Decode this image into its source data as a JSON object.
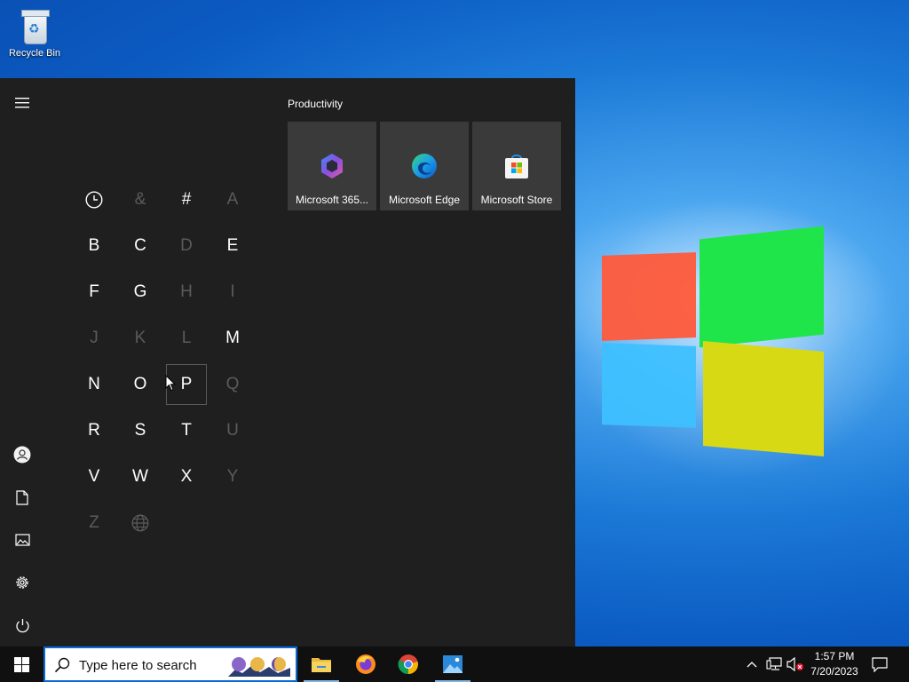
{
  "desktop": {
    "icons": [
      {
        "label": "Recycle Bin",
        "icon": "recycle-bin-icon"
      }
    ]
  },
  "start_menu": {
    "rail": [
      "hamburger-menu-icon",
      "user-icon",
      "documents-icon",
      "pictures-icon",
      "settings-icon",
      "power-icon"
    ],
    "letters": [
      {
        "text": "",
        "icon": "clock-icon",
        "active": true
      },
      {
        "text": "&",
        "active": false
      },
      {
        "text": "#",
        "active": true
      },
      {
        "text": "A",
        "active": false
      },
      {
        "text": "B",
        "active": true
      },
      {
        "text": "C",
        "active": true
      },
      {
        "text": "D",
        "active": false
      },
      {
        "text": "E",
        "active": true
      },
      {
        "text": "F",
        "active": true
      },
      {
        "text": "G",
        "active": true
      },
      {
        "text": "H",
        "active": false
      },
      {
        "text": "I",
        "active": false
      },
      {
        "text": "J",
        "active": false
      },
      {
        "text": "K",
        "active": false
      },
      {
        "text": "L",
        "active": false
      },
      {
        "text": "M",
        "active": true
      },
      {
        "text": "N",
        "active": true
      },
      {
        "text": "O",
        "active": true
      },
      {
        "text": "P",
        "active": true,
        "focused": true
      },
      {
        "text": "Q",
        "active": false
      },
      {
        "text": "R",
        "active": true
      },
      {
        "text": "S",
        "active": true
      },
      {
        "text": "T",
        "active": true
      },
      {
        "text": "U",
        "active": false
      },
      {
        "text": "V",
        "active": true
      },
      {
        "text": "W",
        "active": true
      },
      {
        "text": "X",
        "active": true
      },
      {
        "text": "Y",
        "active": false
      },
      {
        "text": "Z",
        "active": false
      },
      {
        "text": "",
        "icon": "globe-icon",
        "active": false
      }
    ],
    "group_title": "Productivity",
    "tiles": [
      {
        "label": "Microsoft 365...",
        "icon": "microsoft-365-icon"
      },
      {
        "label": "Microsoft Edge",
        "icon": "edge-icon"
      },
      {
        "label": "Microsoft Store",
        "icon": "store-icon"
      }
    ]
  },
  "taskbar": {
    "search_placeholder": "Type here to search",
    "apps": [
      "file-explorer-icon",
      "firefox-icon",
      "chrome-icon",
      "photos-icon"
    ],
    "tray": [
      "chevron-up-icon",
      "network-icon",
      "volume-muted-icon"
    ],
    "time": "1:57 PM",
    "date": "7/20/2023",
    "notification_icon": "notification-icon"
  },
  "colors": {
    "start_menu_bg": "#1f1f1f",
    "tile_bg": "#3a3a3a",
    "taskbar_bg": "#101010",
    "accent": "#0a6ad8"
  }
}
